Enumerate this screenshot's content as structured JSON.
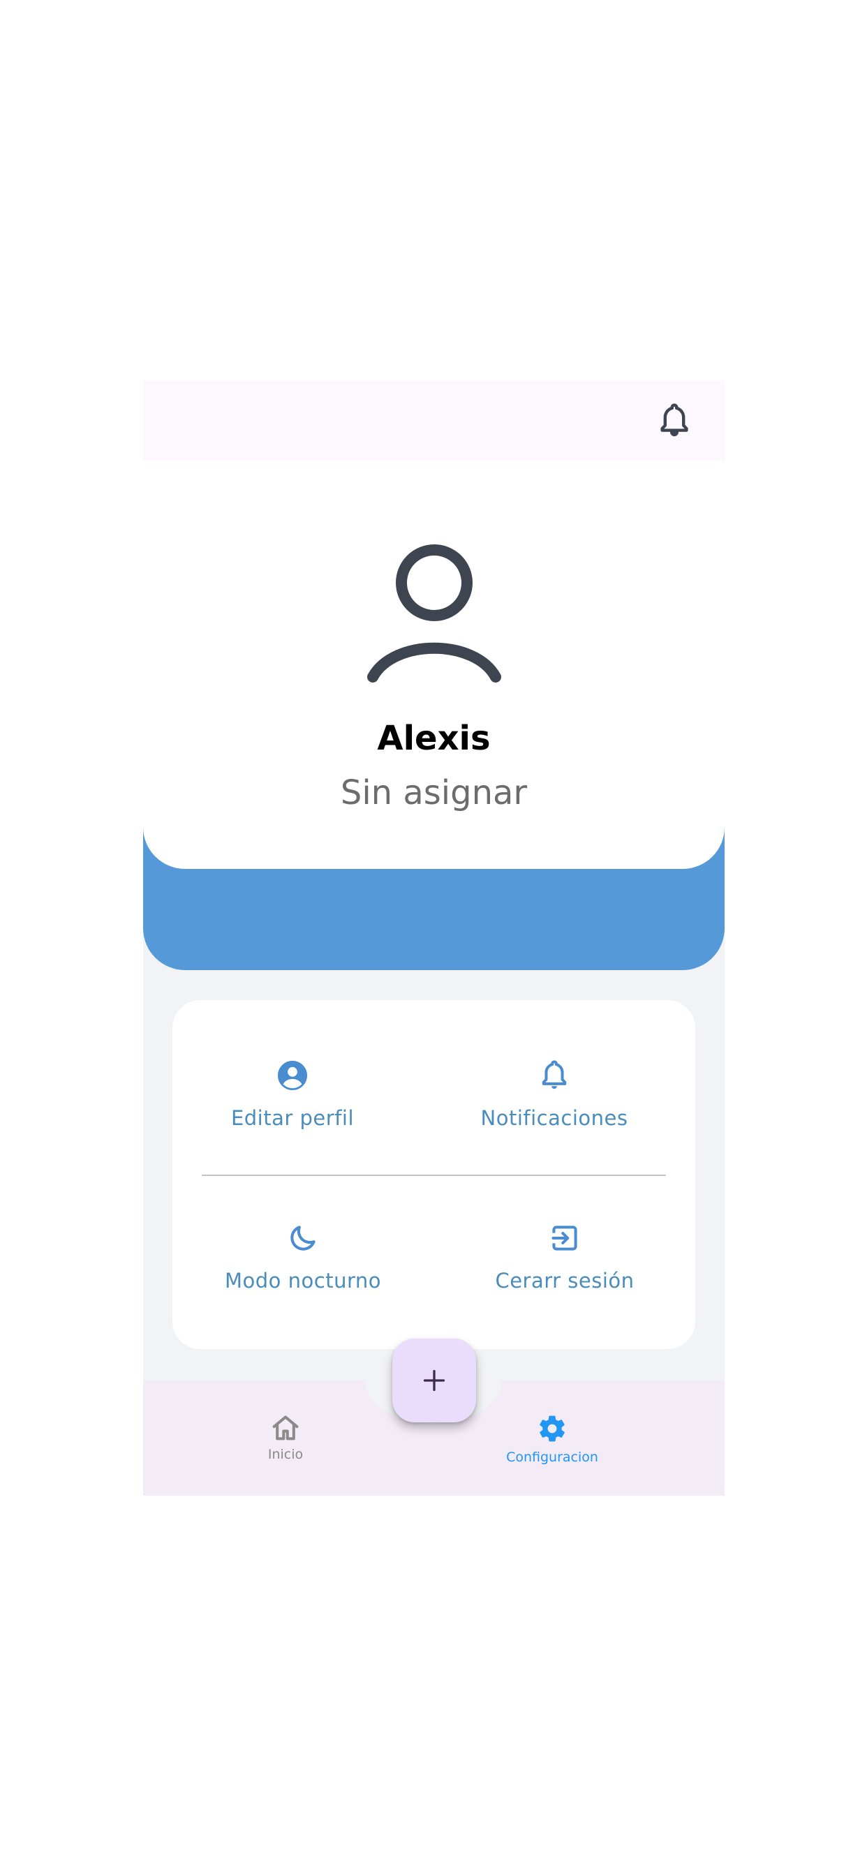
{
  "colors": {
    "accent": "#5599d8",
    "setting_label": "#4a8cbc",
    "nav_active": "#2196f3",
    "nav_inactive": "#8a8a8a",
    "fab_bg": "#eadcfb",
    "icon_dark": "#3f4451"
  },
  "app_bar": {
    "icon": "bell-icon"
  },
  "profile": {
    "avatar_icon": "person-outline-icon",
    "name": "Alexis",
    "role": "Sin asignar"
  },
  "settings": {
    "items": [
      {
        "icon": "account-circle-icon",
        "label": "Editar perfil"
      },
      {
        "icon": "bell-icon",
        "label": "Notificaciones"
      },
      {
        "icon": "moon-icon",
        "label": "Modo nocturno"
      },
      {
        "icon": "logout-icon",
        "label": "Cerarr sesión"
      }
    ]
  },
  "fab": {
    "icon": "plus-icon"
  },
  "bottom_nav": {
    "items": [
      {
        "icon": "home-icon",
        "label": "Inicio",
        "active": false
      },
      {
        "icon": "gear-icon",
        "label": "Configuracion",
        "active": true
      }
    ]
  }
}
